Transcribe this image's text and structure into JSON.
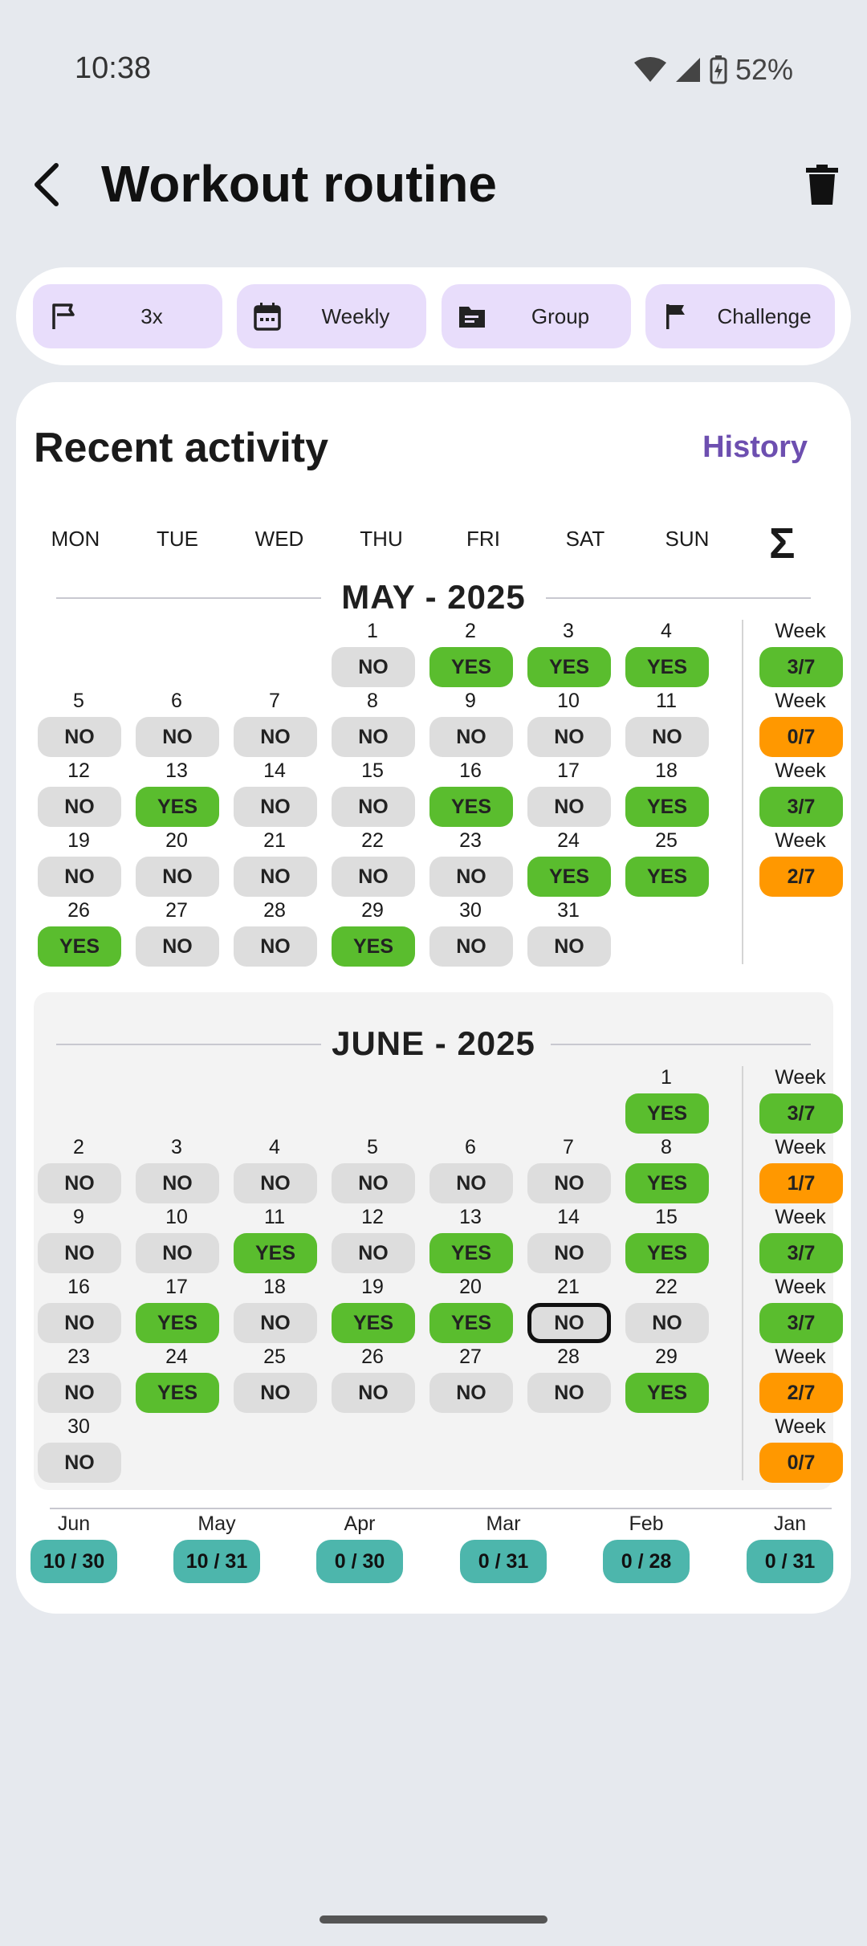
{
  "status": {
    "time": "10:38",
    "battery": "52%"
  },
  "appbar": {
    "title": "Workout routine"
  },
  "chips": [
    {
      "label": "3x",
      "icon": "flag-outline-icon"
    },
    {
      "label": "Weekly",
      "icon": "calendar-icon"
    },
    {
      "label": "Group",
      "icon": "folder-icon"
    },
    {
      "label": "Challenge",
      "icon": "flag-icon"
    }
  ],
  "card": {
    "title": "Recent activity",
    "history": "History"
  },
  "days_of_week": [
    "MON",
    "TUE",
    "WED",
    "THU",
    "FRI",
    "SAT",
    "SUN"
  ],
  "sum_symbol": "Σ",
  "week_label": "Week",
  "months": [
    {
      "title": "MAY - 2025",
      "weeks": [
        {
          "days": [
            null,
            null,
            null,
            {
              "n": "1",
              "v": "NO"
            },
            {
              "n": "2",
              "v": "YES"
            },
            {
              "n": "3",
              "v": "YES"
            },
            {
              "n": "4",
              "v": "YES"
            }
          ],
          "summary": "3/7",
          "summary_color": "green"
        },
        {
          "days": [
            {
              "n": "5",
              "v": "NO"
            },
            {
              "n": "6",
              "v": "NO"
            },
            {
              "n": "7",
              "v": "NO"
            },
            {
              "n": "8",
              "v": "NO"
            },
            {
              "n": "9",
              "v": "NO"
            },
            {
              "n": "10",
              "v": "NO"
            },
            {
              "n": "11",
              "v": "NO"
            }
          ],
          "summary": "0/7",
          "summary_color": "orange"
        },
        {
          "days": [
            {
              "n": "12",
              "v": "NO"
            },
            {
              "n": "13",
              "v": "YES"
            },
            {
              "n": "14",
              "v": "NO"
            },
            {
              "n": "15",
              "v": "NO"
            },
            {
              "n": "16",
              "v": "YES"
            },
            {
              "n": "17",
              "v": "NO"
            },
            {
              "n": "18",
              "v": "YES"
            }
          ],
          "summary": "3/7",
          "summary_color": "green"
        },
        {
          "days": [
            {
              "n": "19",
              "v": "NO"
            },
            {
              "n": "20",
              "v": "NO"
            },
            {
              "n": "21",
              "v": "NO"
            },
            {
              "n": "22",
              "v": "NO"
            },
            {
              "n": "23",
              "v": "NO"
            },
            {
              "n": "24",
              "v": "YES"
            },
            {
              "n": "25",
              "v": "YES"
            }
          ],
          "summary": "2/7",
          "summary_color": "orange"
        },
        {
          "days": [
            {
              "n": "26",
              "v": "YES"
            },
            {
              "n": "27",
              "v": "NO"
            },
            {
              "n": "28",
              "v": "NO"
            },
            {
              "n": "29",
              "v": "YES"
            },
            {
              "n": "30",
              "v": "NO"
            },
            {
              "n": "31",
              "v": "NO"
            },
            null
          ],
          "summary": null,
          "summary_color": null
        }
      ]
    },
    {
      "title": "JUNE - 2025",
      "weeks": [
        {
          "days": [
            null,
            null,
            null,
            null,
            null,
            null,
            {
              "n": "1",
              "v": "YES"
            }
          ],
          "summary": "3/7",
          "summary_color": "green"
        },
        {
          "days": [
            {
              "n": "2",
              "v": "NO"
            },
            {
              "n": "3",
              "v": "NO"
            },
            {
              "n": "4",
              "v": "NO"
            },
            {
              "n": "5",
              "v": "NO"
            },
            {
              "n": "6",
              "v": "NO"
            },
            {
              "n": "7",
              "v": "NO"
            },
            {
              "n": "8",
              "v": "YES"
            }
          ],
          "summary": "1/7",
          "summary_color": "orange"
        },
        {
          "days": [
            {
              "n": "9",
              "v": "NO"
            },
            {
              "n": "10",
              "v": "NO"
            },
            {
              "n": "11",
              "v": "YES"
            },
            {
              "n": "12",
              "v": "NO"
            },
            {
              "n": "13",
              "v": "YES"
            },
            {
              "n": "14",
              "v": "NO"
            },
            {
              "n": "15",
              "v": "YES"
            }
          ],
          "summary": "3/7",
          "summary_color": "green"
        },
        {
          "days": [
            {
              "n": "16",
              "v": "NO"
            },
            {
              "n": "17",
              "v": "YES"
            },
            {
              "n": "18",
              "v": "NO"
            },
            {
              "n": "19",
              "v": "YES"
            },
            {
              "n": "20",
              "v": "YES"
            },
            {
              "n": "21",
              "v": "NO",
              "today": true
            },
            {
              "n": "22",
              "v": "NO"
            }
          ],
          "summary": "3/7",
          "summary_color": "green"
        },
        {
          "days": [
            {
              "n": "23",
              "v": "NO"
            },
            {
              "n": "24",
              "v": "YES"
            },
            {
              "n": "25",
              "v": "NO"
            },
            {
              "n": "26",
              "v": "NO"
            },
            {
              "n": "27",
              "v": "NO"
            },
            {
              "n": "28",
              "v": "NO"
            },
            {
              "n": "29",
              "v": "YES"
            }
          ],
          "summary": "2/7",
          "summary_color": "orange"
        },
        {
          "days": [
            {
              "n": "30",
              "v": "NO"
            },
            null,
            null,
            null,
            null,
            null,
            null
          ],
          "summary": "0/7",
          "summary_color": "orange"
        }
      ]
    }
  ],
  "monthly_summary": [
    {
      "month": "Jun",
      "value": "10 / 30"
    },
    {
      "month": "May",
      "value": "10 / 31"
    },
    {
      "month": "Apr",
      "value": "0 / 30"
    },
    {
      "month": "Mar",
      "value": "0 / 31"
    },
    {
      "month": "Feb",
      "value": "0 / 28"
    },
    {
      "month": "Jan",
      "value": "0 / 31"
    }
  ],
  "colors": {
    "yes": "#5abd2e",
    "no": "#dddddd",
    "orange": "#ff9800",
    "teal": "#4db6ac",
    "accent": "#6d4fb0",
    "chip": "#e8ddfb"
  }
}
